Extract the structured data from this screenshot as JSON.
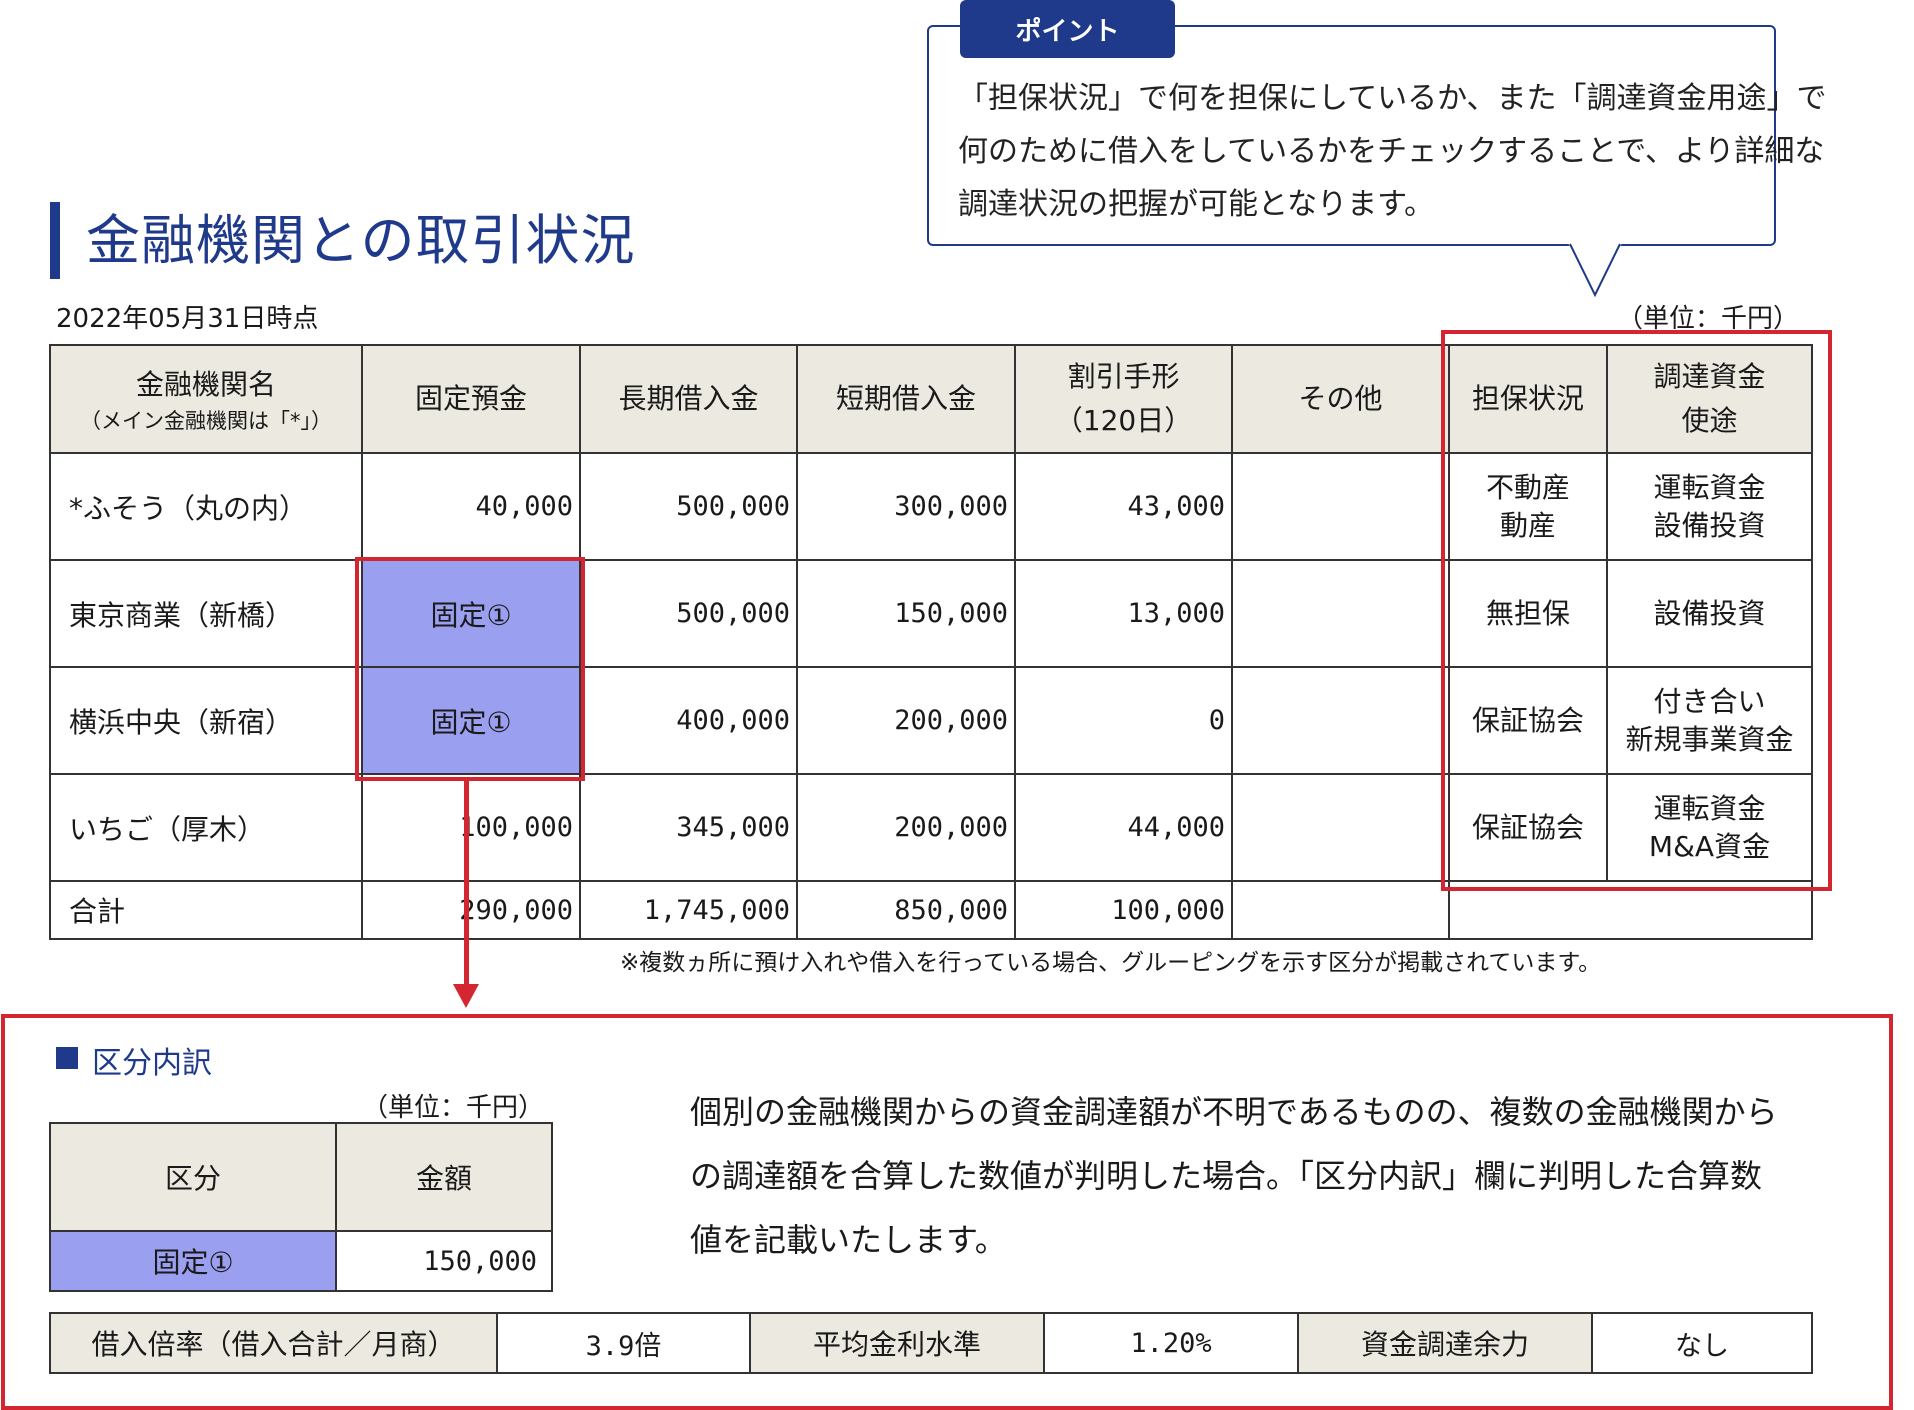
{
  "point": {
    "tab_label": "ポイント",
    "lines": [
      "「担保状況」で何を担保にしているか、また「調達資金用途」で",
      "何のために借入をしているかをチェックすることで、より詳細な",
      "調達状況の把握が可能となります。"
    ]
  },
  "title": "金融機関との取引状況",
  "as_of": "2022年05月31日時点",
  "unit": "（単位：千円）",
  "table": {
    "headers": {
      "name": "金融機関名",
      "name_sub": "（メイン金融機関は「*」）",
      "fixed_deposit": "固定預金",
      "long_term": "長期借入金",
      "short_term": "短期借入金",
      "discount": "割引手形",
      "discount_sub": "（120日）",
      "other": "その他",
      "collateral": "担保状況",
      "purpose_1": "調達資金",
      "purpose_2": "使途"
    },
    "rows": [
      {
        "name": "*ふそう（丸の内）",
        "fixed": "40,000",
        "long": "500,000",
        "short": "300,000",
        "discount": "43,000",
        "other": "",
        "collateral_1": "不動産",
        "collateral_2": "動産",
        "purpose_1": "運転資金",
        "purpose_2": "設備投資"
      },
      {
        "name": "東京商業（新橋）",
        "fixed": "固定①",
        "long": "500,000",
        "short": "150,000",
        "discount": "13,000",
        "other": "",
        "collateral_1": "無担保",
        "collateral_2": "",
        "purpose_1": "設備投資",
        "purpose_2": ""
      },
      {
        "name": "横浜中央（新宿）",
        "fixed": "固定①",
        "long": "400,000",
        "short": "200,000",
        "discount": "0",
        "other": "",
        "collateral_1": "保証協会",
        "collateral_2": "",
        "purpose_1": "付き合い",
        "purpose_2": "新規事業資金"
      },
      {
        "name": "いちご（厚木）",
        "fixed": "100,000",
        "long": "345,000",
        "short": "200,000",
        "discount": "44,000",
        "other": "",
        "collateral_1": "保証協会",
        "collateral_2": "",
        "purpose_1": "運転資金",
        "purpose_2": "M&A資金"
      }
    ],
    "total": {
      "label": "合計",
      "fixed": "290,000",
      "long": "1,745,000",
      "short": "850,000",
      "discount": "100,000",
      "other": ""
    }
  },
  "note": "※複数ヵ所に預け入れや借入を行っている場合、グルーピングを示す区分が掲載されています。",
  "breakdown": {
    "title": "区分内訳",
    "unit": "（単位：千円）",
    "headers": {
      "category": "区分",
      "amount": "金額"
    },
    "rows": [
      {
        "category": "固定①",
        "amount": "150,000"
      }
    ],
    "description": [
      "個別の金融機関からの資金調達額が不明であるものの、複数の金融機関から",
      "の調達額を合算した数値が判明した場合。「区分内訳」欄に判明した合算数",
      "値を記載いたします。"
    ]
  },
  "ratios": {
    "borrow_ratio_label": "借入倍率（借入合計／月商）",
    "borrow_ratio_value": "3.9倍",
    "avg_rate_label": "平均金利水準",
    "avg_rate_value": "1.20%",
    "capacity_label": "資金調達余力",
    "capacity_value": "なし"
  },
  "colors": {
    "navy": "#1f3a8a",
    "highlight_blue": "#9b9ff0",
    "header_gray": "#ebe9e0",
    "red": "#d32630"
  }
}
